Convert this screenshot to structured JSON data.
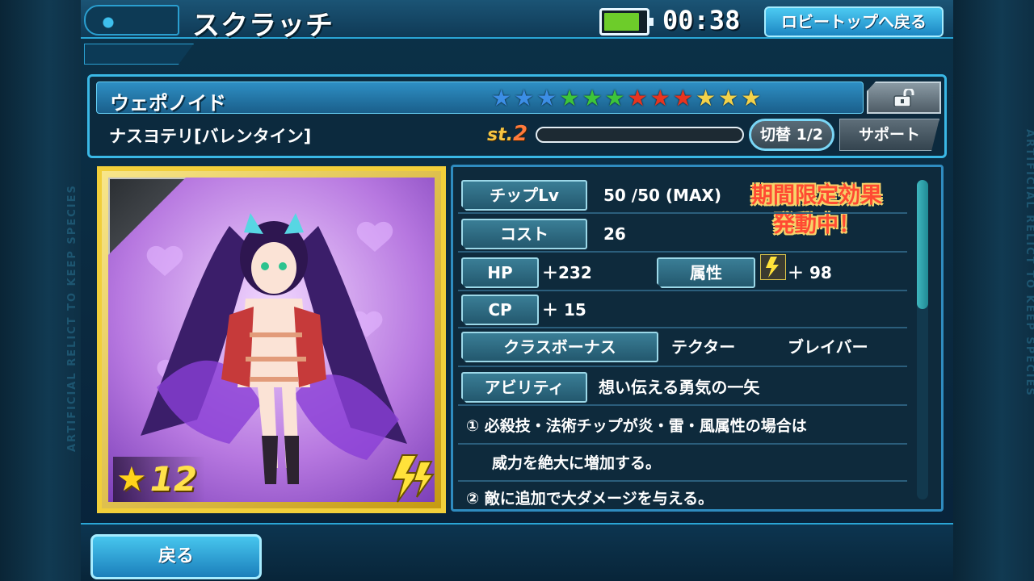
{
  "header": {
    "title": "スクラッチ",
    "battery_level": 0.85,
    "timer": "00:38",
    "lobby_button": "ロビートップへ戻る"
  },
  "chip": {
    "type": "ウェポノイド",
    "name": "ナスヨテリ[バレンタイン]",
    "stage_label": "st.",
    "stage_num": "2",
    "stage_progress": 0,
    "toggle_label": "切替 1/2",
    "support_label": "サポート",
    "stars": [
      {
        "color": "#3c8ee6"
      },
      {
        "color": "#3c8ee6"
      },
      {
        "color": "#3c8ee6"
      },
      {
        "color": "#3dc53a"
      },
      {
        "color": "#3dc53a"
      },
      {
        "color": "#3dc53a"
      },
      {
        "color": "#e8341f"
      },
      {
        "color": "#e8341f"
      },
      {
        "color": "#e8341f"
      },
      {
        "color": "#f3d24a"
      },
      {
        "color": "#f3d24a"
      },
      {
        "color": "#f3d24a"
      }
    ]
  },
  "card": {
    "rarity_star": "★",
    "rarity_num": "12",
    "element": "lightning"
  },
  "stats": {
    "limited_line1": "期間限定効果",
    "limited_line2": "発動中！",
    "chip_lv_label": "チップLv",
    "chip_lv_value": "50 /50 (MAX)",
    "cost_label": "コスト",
    "cost_value": "26",
    "hp_label": "HP",
    "hp_value": "＋232",
    "attr_label": "属性",
    "attr_value": "＋ 98",
    "cp_label": "CP",
    "cp_value": "＋ 15",
    "class_bonus_label": "クラスボーナス",
    "class_bonus_1": "テクター",
    "class_bonus_2": "ブレイバー",
    "ability_label": "アビリティ",
    "ability_name": "想い伝える勇気の一矢",
    "desc_1": "① 必殺技・法術チップが炎・雷・風属性の場合は",
    "desc_2": "威力を絶大に増加する。",
    "desc_3": "② 敵に追加で大ダメージを与える。"
  },
  "footer": {
    "back_label": "戻る"
  },
  "side_text": "ARTIFICIAL RELICT TO KEEP SPECIES"
}
